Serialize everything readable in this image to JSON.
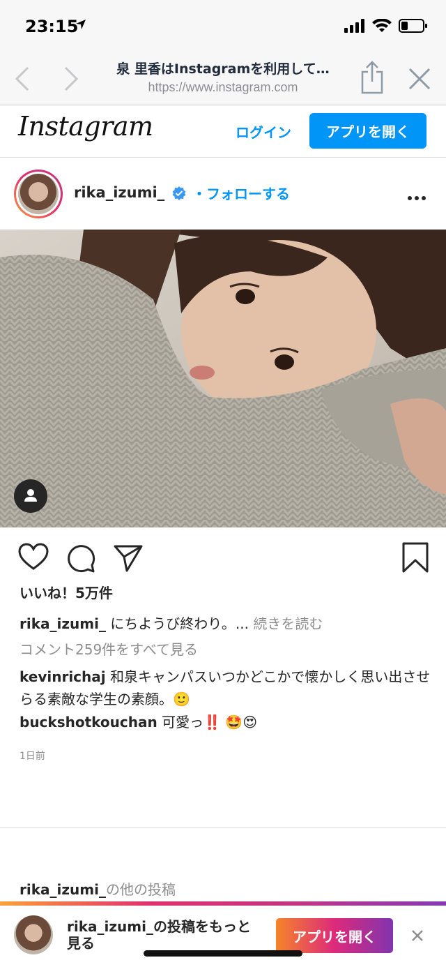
{
  "status_bar": {
    "time": "23:15",
    "icons": [
      "location-arrow-icon",
      "signal-icon",
      "wifi-icon",
      "battery-icon"
    ]
  },
  "browser": {
    "page_title": "泉 里香はInstagramを利用して…",
    "url": "https://www.instagram.com",
    "icons": [
      "back-icon",
      "forward-icon",
      "share-icon",
      "close-icon"
    ]
  },
  "header": {
    "logo": "Instagram",
    "login_label": "ログイン",
    "open_app_label": "アプリを開く"
  },
  "post": {
    "username": "rika_izumi_",
    "follow_label": "・フォローする",
    "likes": "いいね！5万件",
    "caption_user": "rika_izumi_",
    "caption_text": " にちようび終わり。... ",
    "caption_more": "続きを読む",
    "view_comments": "コメント259件をすべて見る",
    "comments": [
      {
        "user": "kevinrichaj",
        "text": " 和泉キャンパスいつかどこかで懐かしく思い出させらる素敵な学生の素顔。🙂"
      },
      {
        "user": "buckshotkouchan",
        "text": " 可愛っ‼️ 🤩😍"
      }
    ],
    "timestamp": "1日前"
  },
  "more_posts": {
    "user": "rika_izumi_",
    "suffix": "の他の投稿"
  },
  "banner": {
    "text": "rika_izumi_の投稿をもっと見る",
    "button": "アプリを開く"
  },
  "colors": {
    "accent": "#0095f6",
    "text": "#262626",
    "muted": "#8e8e8e"
  }
}
